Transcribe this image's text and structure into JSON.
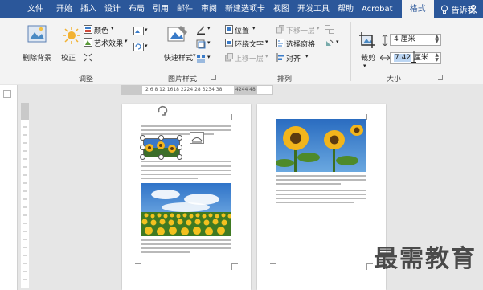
{
  "tabs": [
    {
      "label": "文件"
    },
    {
      "label": "开始"
    },
    {
      "label": "插入"
    },
    {
      "label": "设计"
    },
    {
      "label": "布局"
    },
    {
      "label": "引用"
    },
    {
      "label": "邮件"
    },
    {
      "label": "审阅"
    },
    {
      "label": "新建选项卡"
    },
    {
      "label": "视图"
    },
    {
      "label": "开发工具"
    },
    {
      "label": "帮助"
    },
    {
      "label": "Acrobat"
    }
  ],
  "active_tab": "格式",
  "tell_me": "告诉我",
  "ribbon": {
    "remove_bg": "删除背景",
    "correct": "校正",
    "color": "颜色",
    "art_effect": "艺术效果",
    "group_adjust": "调整",
    "quick_style": "快速样式",
    "group_picture_style": "图片样式",
    "position": "位置",
    "wrap_text": "环绕文字",
    "bring_forward": "上移一层",
    "send_backward": "下移一层",
    "selection_pane": "选择窗格",
    "align": "对齐",
    "group_arrange": "排列",
    "crop": "裁剪",
    "height_value": "4 厘米",
    "width_selected": "7.42",
    "width_unit": " 厘米",
    "group_size": "大小"
  },
  "ruler": {
    "numbers": "2  6 8  12  1618  2224  28  3234  38",
    "numbers2": "4244  48"
  },
  "watermark": "最需教育",
  "colors": {
    "title_bar": "#2b579a",
    "ribbon_bg": "#f3f3f3",
    "canvas_bg": "#e6e6e6",
    "selection": "#bcd6f3"
  }
}
